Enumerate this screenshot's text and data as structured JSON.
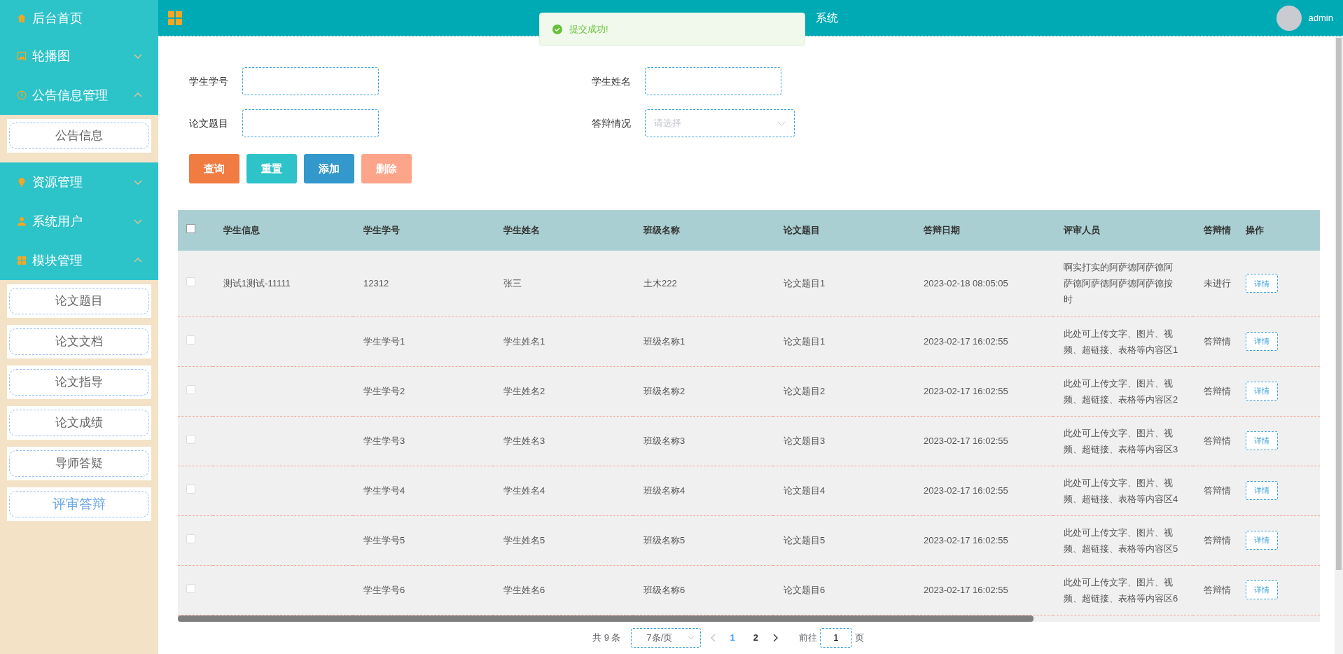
{
  "header": {
    "title": "系统",
    "user": "admin"
  },
  "toast": {
    "message": "提交成功!"
  },
  "sidebar": {
    "items": [
      {
        "label": "后台首页"
      },
      {
        "label": "轮播图",
        "expanded": false
      },
      {
        "label": "公告信息管理",
        "expanded": true,
        "children": [
          {
            "label": "公告信息",
            "selected": false
          }
        ]
      },
      {
        "label": "资源管理",
        "expanded": false
      },
      {
        "label": "系统用户",
        "expanded": false
      },
      {
        "label": "模块管理",
        "expanded": true,
        "children": [
          {
            "label": "论文题目",
            "selected": false
          },
          {
            "label": "论文文档",
            "selected": false
          },
          {
            "label": "论文指导",
            "selected": false
          },
          {
            "label": "论文成绩",
            "selected": false
          },
          {
            "label": "导师答疑",
            "selected": false
          },
          {
            "label": "评审答辩",
            "selected": true
          }
        ]
      }
    ]
  },
  "filters": [
    {
      "label": "学生学号",
      "kind": "input"
    },
    {
      "label": "学生姓名",
      "kind": "input"
    },
    {
      "label": "论文题目",
      "kind": "input"
    },
    {
      "label": "答辩情况",
      "kind": "select",
      "placeholder": "请选择"
    }
  ],
  "buttons": [
    {
      "label": "查询",
      "color": "#f07c42"
    },
    {
      "label": "重置",
      "color": "#2ec3c8"
    },
    {
      "label": "添加",
      "color": "#3398cc"
    },
    {
      "label": "删除",
      "color": "#fca58a"
    }
  ],
  "table": {
    "header_checked": false,
    "columns": [
      "学生信息",
      "学生学号",
      "学生姓名",
      "班级名称",
      "论文题目",
      "答辩日期",
      "评审人员",
      "答辩情",
      "操作"
    ],
    "rows": [
      {
        "checked": false,
        "cells": [
          "测试1测试-11111",
          "12312",
          "张三",
          "土木222",
          "论文题目1",
          "2023-02-18 08:05:05",
          "啊实打实的阿萨德阿萨德阿萨德阿萨德阿萨德阿萨德按时",
          "未进行"
        ],
        "action": "详情"
      },
      {
        "checked": false,
        "cells": [
          "",
          "学生学号1",
          "学生姓名1",
          "班级名称1",
          "论文题目1",
          "2023-02-17 16:02:55",
          "此处可上传文字、图片、视频、超链接、表格等内容区1",
          "答辩情"
        ],
        "action": "详情"
      },
      {
        "checked": false,
        "cells": [
          "",
          "学生学号2",
          "学生姓名2",
          "班级名称2",
          "论文题目2",
          "2023-02-17 16:02:55",
          "此处可上传文字、图片、视频、超链接、表格等内容区2",
          "答辩情"
        ],
        "action": "详情"
      },
      {
        "checked": false,
        "cells": [
          "",
          "学生学号3",
          "学生姓名3",
          "班级名称3",
          "论文题目3",
          "2023-02-17 16:02:55",
          "此处可上传文字、图片、视频、超链接、表格等内容区3",
          "答辩情"
        ],
        "action": "详情"
      },
      {
        "checked": false,
        "cells": [
          "",
          "学生学号4",
          "学生姓名4",
          "班级名称4",
          "论文题目4",
          "2023-02-17 16:02:55",
          "此处可上传文字、图片、视频、超链接、表格等内容区4",
          "答辩情"
        ],
        "action": "详情"
      },
      {
        "checked": false,
        "cells": [
          "",
          "学生学号5",
          "学生姓名5",
          "班级名称5",
          "论文题目5",
          "2023-02-17 16:02:55",
          "此处可上传文字、图片、视频、超链接、表格等内容区5",
          "答辩情"
        ],
        "action": "详情"
      },
      {
        "checked": false,
        "cells": [
          "",
          "学生学号6",
          "学生姓名6",
          "班级名称6",
          "论文题目6",
          "2023-02-17 16:02:55",
          "此处可上传文字、图片、视频、超链接、表格等内容区6",
          "答辩情"
        ],
        "action": "详情"
      }
    ]
  },
  "pagination": {
    "total": "共 9 条",
    "page_size": "7条/页",
    "pages": [
      {
        "label": "1",
        "selected": true
      },
      {
        "label": "2",
        "selected": false
      }
    ],
    "goto_label": "前往",
    "goto_value": "1",
    "goto_suffix": "页"
  }
}
